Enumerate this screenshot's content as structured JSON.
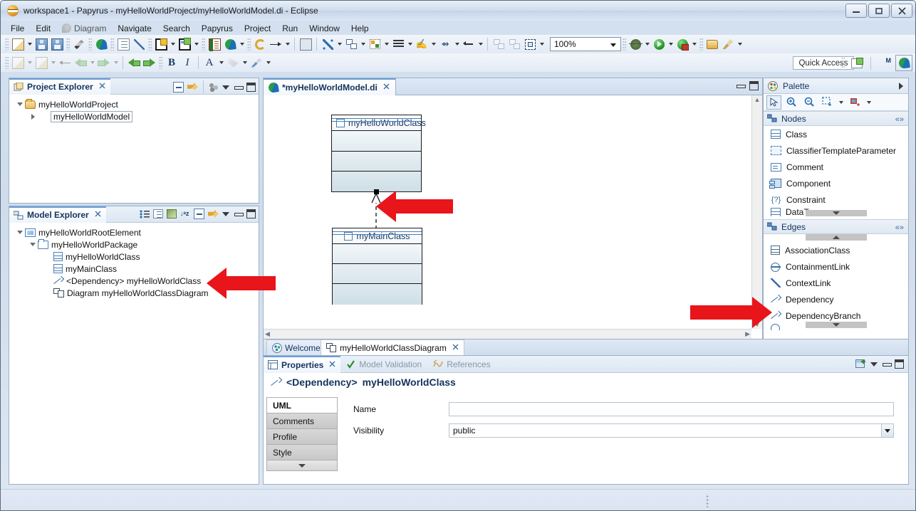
{
  "window": {
    "title": "workspace1 - Papyrus - myHelloWorldProject/myHelloWorldModel.di - Eclipse",
    "minimize": "—",
    "restore": "❐",
    "close": "✕"
  },
  "menubar": {
    "items": [
      {
        "label": "File"
      },
      {
        "label": "Edit"
      },
      {
        "label": "Diagram"
      },
      {
        "label": "Navigate"
      },
      {
        "label": "Search"
      },
      {
        "label": "Papyrus"
      },
      {
        "label": "Project"
      },
      {
        "label": "Run"
      },
      {
        "label": "Window"
      },
      {
        "label": "Help"
      }
    ]
  },
  "toolbar": {
    "zoom_level": "100%",
    "quick_access": "Quick Access"
  },
  "project_explorer": {
    "title": "Project Explorer",
    "close": "✕",
    "tree": [
      {
        "label": "myHelloWorldProject",
        "icon": "folder-icon",
        "expanded": true,
        "depth": 0
      },
      {
        "label": "myHelloWorldModel",
        "icon": "papyrus-model-icon",
        "expanded": false,
        "depth": 1,
        "selected": true
      }
    ]
  },
  "model_explorer": {
    "title": "Model Explorer",
    "close": "✕",
    "tree": [
      {
        "label": "myHelloWorldRootElement",
        "icon": "root-element-icon",
        "expanded": true,
        "depth": 0
      },
      {
        "label": "myHelloWorldPackage",
        "icon": "package-icon",
        "expanded": true,
        "depth": 1
      },
      {
        "label": "myHelloWorldClass",
        "icon": "class-icon",
        "depth": 2
      },
      {
        "label": "myMainClass",
        "icon": "class-icon",
        "depth": 2
      },
      {
        "label": "<Dependency> myHelloWorldClass",
        "icon": "dependency-icon",
        "depth": 2
      },
      {
        "label": "Diagram myHelloWorldClassDiagram",
        "icon": "diagram-icon",
        "depth": 2
      }
    ]
  },
  "editor": {
    "tab_label": "*myHelloWorldModel.di",
    "tab_close": "✕",
    "classes": [
      {
        "name": "myHelloWorldClass",
        "compartments": 3
      },
      {
        "name": "myMainClass",
        "compartments": 3
      }
    ],
    "relationship": "dependency"
  },
  "palette": {
    "title": "Palette",
    "tools": [
      "select-tool",
      "zoom-in-tool",
      "zoom-out-tool",
      "marquee-tool",
      "format-tool"
    ],
    "groups": [
      {
        "label": "Nodes",
        "items": [
          {
            "label": "Class",
            "icon": "class-icon"
          },
          {
            "label": "ClassifierTemplateParameter",
            "icon": "classifier-template-parameter-icon"
          },
          {
            "label": "Comment",
            "icon": "comment-icon"
          },
          {
            "label": "Component",
            "icon": "component-icon"
          },
          {
            "label": "Constraint",
            "icon": "constraint-icon"
          },
          {
            "label": "DataType",
            "icon": "datatype-icon"
          }
        ]
      },
      {
        "label": "Edges",
        "items": [
          {
            "label": "AssociationClass",
            "icon": "association-class-icon"
          },
          {
            "label": "ContainmentLink",
            "icon": "containment-link-icon"
          },
          {
            "label": "ContextLink",
            "icon": "context-link-icon"
          },
          {
            "label": "Dependency",
            "icon": "dependency-icon"
          },
          {
            "label": "DependencyBranch",
            "icon": "dependency-branch-icon"
          }
        ]
      }
    ]
  },
  "bottom_tabs": [
    {
      "label": "Welcome",
      "icon": "welcome-icon",
      "active": false
    },
    {
      "label": "myHelloWorldClassDiagram",
      "icon": "diagram-icon",
      "active": true,
      "close": "✕"
    }
  ],
  "properties": {
    "tabs": [
      {
        "label": "Properties",
        "icon": "properties-icon",
        "active": true,
        "close": "✕"
      },
      {
        "label": "Model Validation",
        "icon": "check-icon",
        "active": false
      },
      {
        "label": "References",
        "icon": "references-icon",
        "active": false
      }
    ],
    "header_prefix": "<Dependency>",
    "header_name": "myHelloWorldClass",
    "side_tabs": [
      {
        "label": "UML",
        "active": true
      },
      {
        "label": "Comments",
        "active": false
      },
      {
        "label": "Profile",
        "active": false
      },
      {
        "label": "Style",
        "active": false
      }
    ],
    "fields": [
      {
        "label": "Name",
        "value": "",
        "type": "text"
      },
      {
        "label": "Visibility",
        "value": "public",
        "type": "combo"
      }
    ]
  },
  "colors": {
    "accent": "#6a9fd8",
    "annotation_red": "#e8151b",
    "title_blue": "#14335e"
  }
}
